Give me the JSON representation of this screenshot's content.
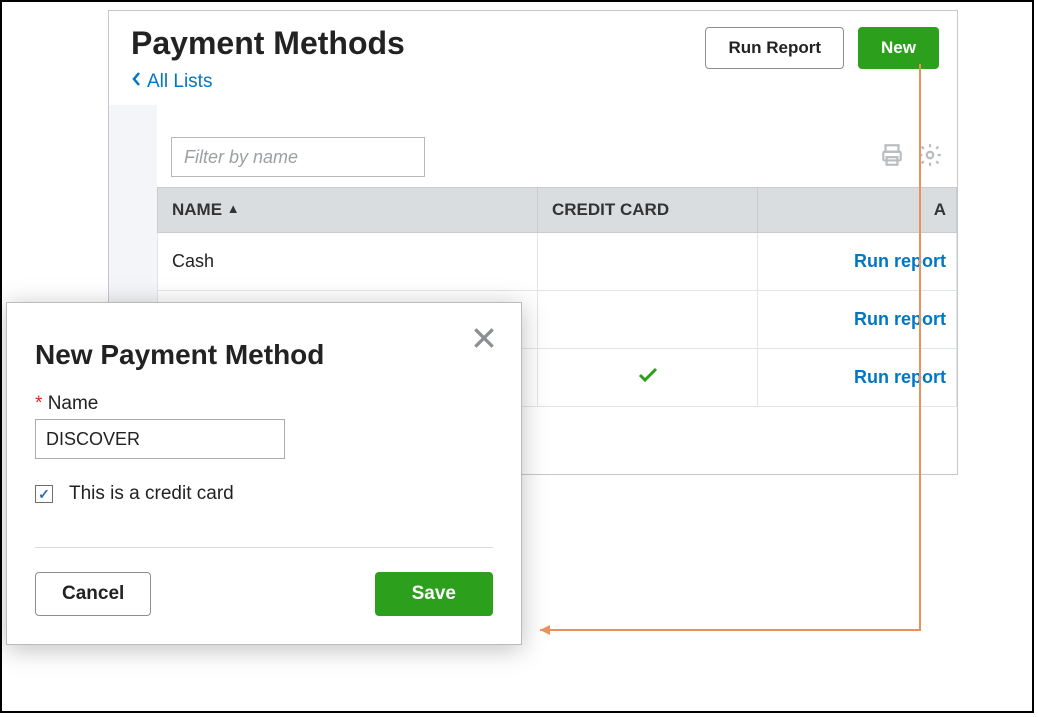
{
  "header": {
    "title": "Payment Methods",
    "run_report_label": "Run Report",
    "new_label": "New",
    "back_link": "All Lists"
  },
  "filter": {
    "placeholder": "Filter by name"
  },
  "columns": {
    "name": "NAME",
    "credit_card": "CREDIT CARD",
    "action_initial": "A"
  },
  "rows": [
    {
      "name": "Cash",
      "credit_card": false,
      "action": "Run report"
    },
    {
      "name": "",
      "credit_card": false,
      "action": "Run report"
    },
    {
      "name": "",
      "credit_card": true,
      "action": "Run report"
    }
  ],
  "modal": {
    "title": "New Payment Method",
    "name_label": "Name",
    "name_value": "DISCOVER",
    "checkbox_label": "This is a credit card",
    "checkbox_checked": true,
    "cancel_label": "Cancel",
    "save_label": "Save"
  }
}
